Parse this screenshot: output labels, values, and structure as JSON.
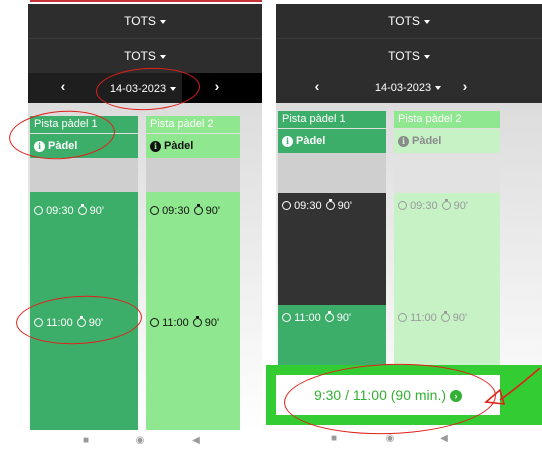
{
  "filters": {
    "select_1": "TOTS",
    "select_2": "TOTS"
  },
  "date_nav": {
    "prev": "‹",
    "date": "14-03-2023",
    "next": "›"
  },
  "courts": [
    {
      "name": "Pista pàdel 1",
      "sport": "Pàdel"
    },
    {
      "name": "Pista pàdel 2",
      "sport": "Pàdel"
    }
  ],
  "slots": [
    {
      "time": "09:30",
      "duration": "90'"
    },
    {
      "time": "11:00",
      "duration": "90'"
    }
  ],
  "summary": {
    "text": "9:30 / 11:00 (90 min.)",
    "go_icon": "›"
  },
  "softkeys": {
    "recent": "■",
    "home": "◉",
    "back": "◀"
  },
  "colors": {
    "toolbar": "#2d2d2d",
    "court1": "#3dae6a",
    "court2": "#8fe88f",
    "selected_slot": "#333333",
    "summary_border": "#33cc33",
    "annotation": "#e0201a"
  }
}
